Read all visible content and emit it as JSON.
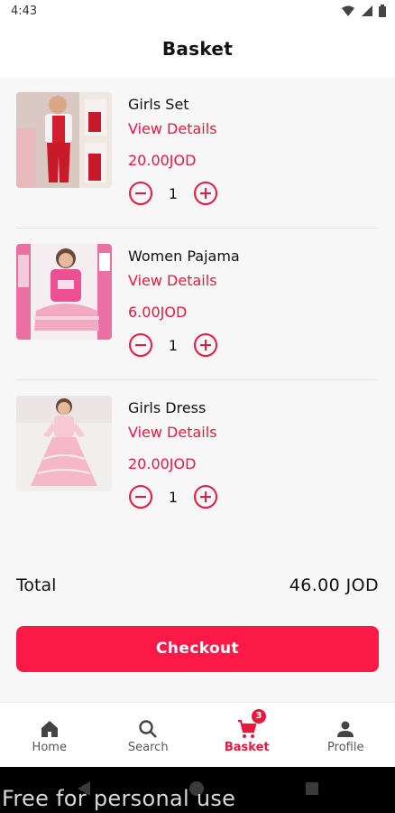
{
  "status_bar": {
    "time": "4:43"
  },
  "header": {
    "title": "Basket"
  },
  "items": [
    {
      "name": "Girls Set",
      "view_details": "View Details",
      "price": "20.00JOD",
      "quantity": "1"
    },
    {
      "name": "Women Pajama",
      "view_details": "View Details",
      "price": "6.00JOD",
      "quantity": "1"
    },
    {
      "name": "Girls Dress",
      "view_details": "View Details",
      "price": "20.00JOD",
      "quantity": "1"
    }
  ],
  "summary": {
    "total_label": "Total",
    "total_value": "46.00 JOD"
  },
  "checkout": {
    "label": "Checkout"
  },
  "nav": {
    "items": [
      {
        "label": "Home",
        "icon": "home-icon"
      },
      {
        "label": "Search",
        "icon": "search-icon"
      },
      {
        "label": "Basket",
        "icon": "cart-icon",
        "badge": "3"
      },
      {
        "label": "Profile",
        "icon": "person-icon"
      }
    ]
  },
  "watermark": "Free for personal use",
  "colors": {
    "accent": "#e8183f",
    "button": "#fb1a47"
  }
}
